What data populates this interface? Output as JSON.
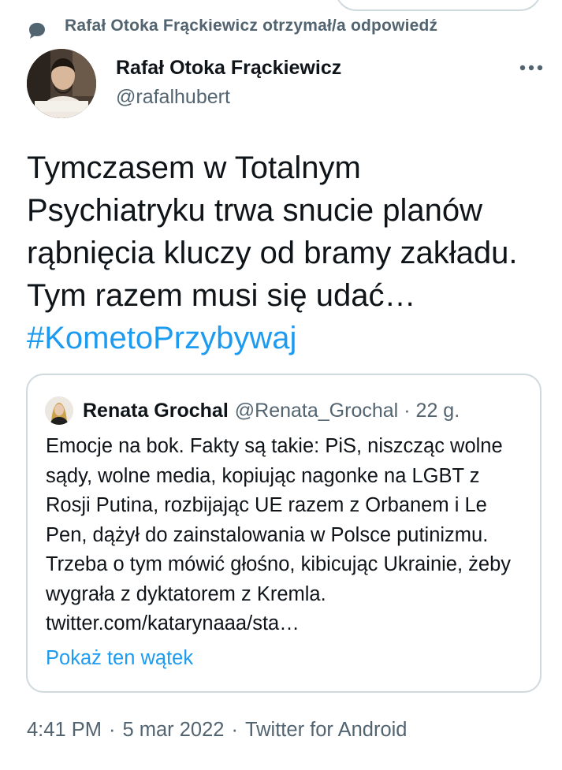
{
  "context": {
    "icon": "reply-bubble-icon",
    "text": "Rafał Otoka Frąckiewicz otrzymał/a odpowiedź"
  },
  "author": {
    "name": "Rafał Otoka Frąckiewicz",
    "handle": "@rafalhubert",
    "more_icon": "more-dots-icon"
  },
  "tweet": {
    "text": "Tymczasem w Totalnym Psychiatryku trwa snucie planów rąbnięcia kluczy od bramy zakładu. Tym razem musi się udać… ",
    "hashtag": "#KometoPrzybywaj"
  },
  "quote": {
    "name": "Renata Grochal",
    "handle": "@Renata_Grochal",
    "separator": "·",
    "time": "22 g.",
    "text": "Emocje na bok. Fakty są takie: PiS, niszcząc wolne sądy, wolne media, kopiując nagonke na LGBT z Rosji Putina, rozbijając UE razem z Orbanem i Le Pen, dążył do zainstalowania w Polsce putinizmu. Trzeba o tym mówić głośno, kibicując Ukrainie, żeby wygrała z dyktatorem z Kremla. twitter.com/katarynaaa/sta…",
    "show_thread": "Pokaż ten wątek"
  },
  "meta": {
    "time": "4:41 PM",
    "separator": "·",
    "date": "5 mar 2022",
    "source": "Twitter for Android"
  },
  "colors": {
    "link": "#1d9bf0",
    "secondary_text": "#536471",
    "primary_text": "#0f1419",
    "border": "#cfd9de"
  }
}
